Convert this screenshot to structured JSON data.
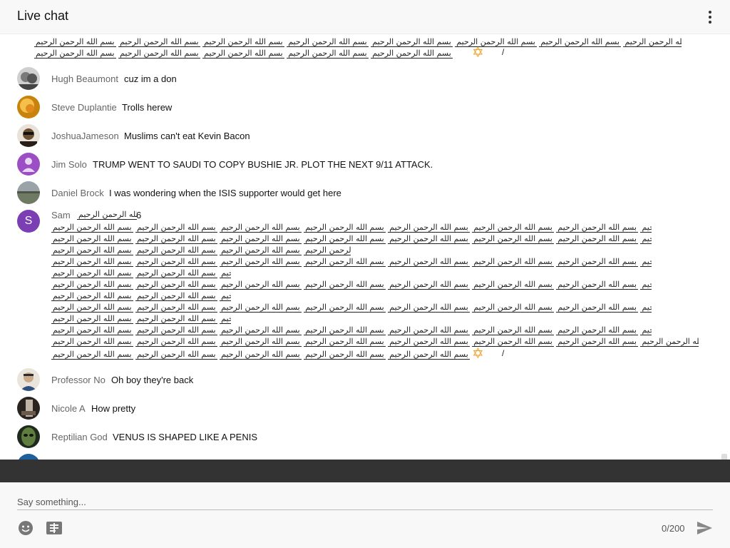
{
  "header": {
    "title": "Live chat"
  },
  "messages": [
    {
      "author": "Hugh Beaumont",
      "text": "cuz im a don",
      "avatar_color": "#7a7a7a"
    },
    {
      "author": "Steve Duplantie",
      "text": "Trolls herew",
      "avatar_color": "#e6a320"
    },
    {
      "author": "JoshuaJameson",
      "text": "Muslims can't eat Kevin Bacon",
      "avatar_color": "#4b3a2a"
    },
    {
      "author": "Jim Solo",
      "text": "TRUMP WENT TO SAUDI TO COPY BUSHIE JR. PLOT THE NEXT 9/11 ATTACK.",
      "avatar_color": "#9c4fc4"
    },
    {
      "author": "Daniel Brock",
      "text": "I was wondering when the ISIS supporter would get here",
      "avatar_color": "#6f7a62"
    },
    {
      "author": "Sam",
      "text": "6",
      "avatar_letter": "S",
      "avatar_color": "#7b3fb3"
    },
    {
      "author": "Professor No",
      "text": "Oh boy they're back",
      "avatar_color": "#d9d2c7"
    },
    {
      "author": "Nicole A",
      "text": "How pretty",
      "avatar_color": "#3a2f2a"
    },
    {
      "author": "Reptilian God",
      "text": "VENUS IS SHAPED LIKE A PENIS",
      "avatar_color": "#2f3f2a"
    }
  ],
  "composer": {
    "placeholder": "Say something...",
    "counter": "0/200"
  },
  "icons": {
    "menu": "more-vert-icon",
    "emoji": "emoji-icon",
    "superchat": "superchat-icon",
    "send": "send-icon"
  },
  "colors": {
    "star": "#f0a020",
    "dark_bar": "#333333"
  }
}
